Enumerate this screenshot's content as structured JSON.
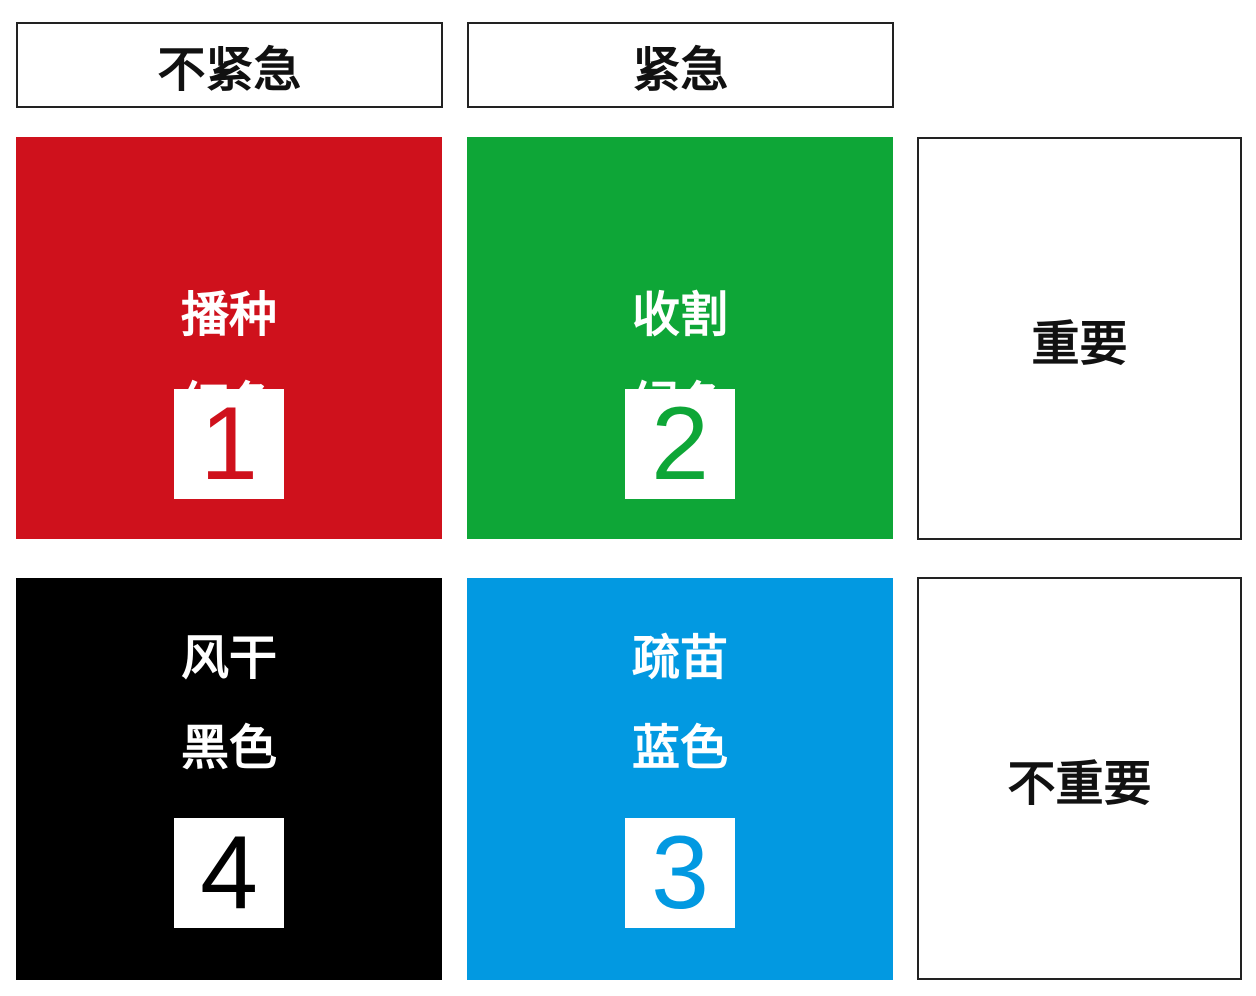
{
  "columns": {
    "not_urgent": "不紧急",
    "urgent": "紧急"
  },
  "rows": {
    "important": "重要",
    "not_important": "不重要"
  },
  "quadrants": [
    {
      "action": "播种",
      "color_name": "红色",
      "number": "1",
      "color": "#cf111c"
    },
    {
      "action": "收割",
      "color_name": "绿色",
      "number": "2",
      "color": "#0ea637"
    },
    {
      "action": "风干",
      "color_name": "黑色",
      "number": "4",
      "color": "#000000"
    },
    {
      "action": "疏苗",
      "color_name": "蓝色",
      "number": "3",
      "color": "#0299e1"
    }
  ]
}
